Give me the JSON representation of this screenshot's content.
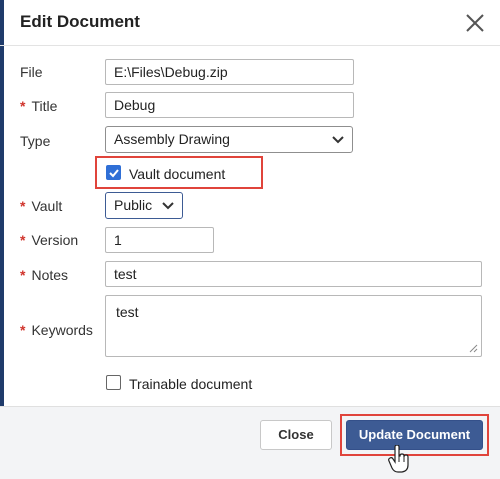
{
  "dialog": {
    "title": "Edit Document"
  },
  "form": {
    "file": {
      "label": "File",
      "value": "E:\\Files\\Debug.zip",
      "required": false
    },
    "title": {
      "label": "Title",
      "value": "Debug",
      "required": true
    },
    "type": {
      "label": "Type",
      "value": "Assembly Drawing",
      "required": false
    },
    "vault_document": {
      "label": "Vault document",
      "checked": true
    },
    "vault": {
      "label": "Vault",
      "value": "Public",
      "required": true
    },
    "version": {
      "label": "Version",
      "value": "1",
      "required": true
    },
    "notes": {
      "label": "Notes",
      "value": "test",
      "required": true
    },
    "keywords": {
      "label": "Keywords",
      "value": "test",
      "required": true
    },
    "trainable_document": {
      "label": "Trainable document",
      "checked": false
    },
    "required_marker": "*"
  },
  "footer": {
    "close_label": "Close",
    "update_label": "Update Document"
  },
  "colors": {
    "accent": "#3d5b94",
    "highlight": "#e0443b",
    "checkbox": "#2f6fd6",
    "required": "#d0342c"
  },
  "icons": {
    "close": "close-icon",
    "dropdown": "chevron-down-icon",
    "check": "checkmark-icon",
    "cursor": "hand-pointer-icon",
    "resize": "resize-grip-icon"
  }
}
